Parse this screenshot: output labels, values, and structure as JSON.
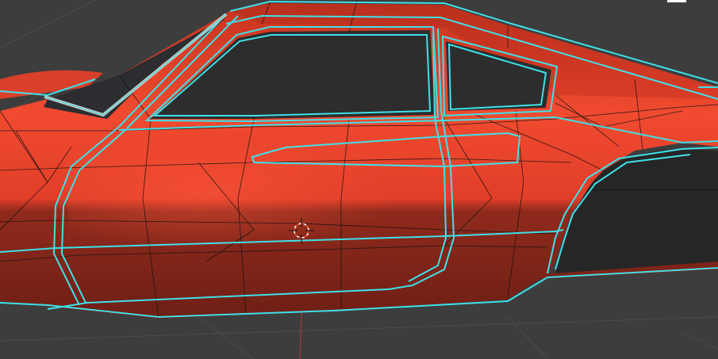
{
  "viewport": {
    "background_color": "#3d3d3d",
    "grid_color": "#4a4a4a",
    "axis_x_color": "#a23a3a",
    "grid_visible": true
  },
  "model": {
    "body_color": "#e8412a",
    "body_shadow_color": "#8c2418",
    "wireframe_color": "#111111",
    "selected_edge_color": "#3fe0e8",
    "glass_color": "#2a2a2a",
    "wheel_arch_color": "#262626",
    "shading": "solid-with-wireframe"
  },
  "cursor": {
    "icon": "3d-cursor-icon",
    "color_primary": "#d94a2a",
    "color_secondary": "#ffffff"
  },
  "overlay": {
    "icon": "header-edge-marker"
  }
}
